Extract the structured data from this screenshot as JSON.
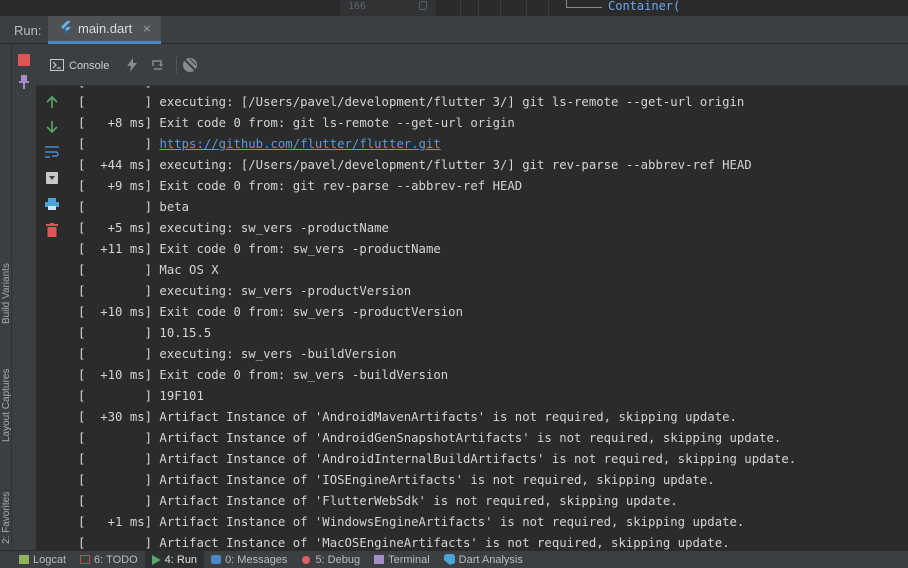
{
  "editor": {
    "line_number": "166",
    "code_fragment": "Container("
  },
  "run_panel": {
    "label": "Run:",
    "tab_label": "main.dart",
    "tab_close": "×"
  },
  "left_stripe": {
    "labels": [
      "Build Variants",
      "Layout Captures",
      "2: Favorites"
    ]
  },
  "toolbar": {
    "console_label": "Console"
  },
  "console_lines": [
    "[        ] executing: [/Users/pavel/development/flutter 3/] git ls-remote --get-url origin",
    "[   +8 ms] Exit code 0 from: git ls-remote --get-url origin",
    "[        ] ",
    "[  +44 ms] executing: [/Users/pavel/development/flutter 3/] git rev-parse --abbrev-ref HEAD",
    "[   +9 ms] Exit code 0 from: git rev-parse --abbrev-ref HEAD",
    "[        ] beta",
    "[   +5 ms] executing: sw_vers -productName",
    "[  +11 ms] Exit code 0 from: sw_vers -productName",
    "[        ] Mac OS X",
    "[        ] executing: sw_vers -productVersion",
    "[  +10 ms] Exit code 0 from: sw_vers -productVersion",
    "[        ] 10.15.5",
    "[        ] executing: sw_vers -buildVersion",
    "[  +10 ms] Exit code 0 from: sw_vers -buildVersion",
    "[        ] 19F101",
    "[  +30 ms] Artifact Instance of 'AndroidMavenArtifacts' is not required, skipping update.",
    "[        ] Artifact Instance of 'AndroidGenSnapshotArtifacts' is not required, skipping update.",
    "[        ] Artifact Instance of 'AndroidInternalBuildArtifacts' is not required, skipping update.",
    "[        ] Artifact Instance of 'IOSEngineArtifacts' is not required, skipping update.",
    "[        ] Artifact Instance of 'FlutterWebSdk' is not required, skipping update.",
    "[   +1 ms] Artifact Instance of 'WindowsEngineArtifacts' is not required, skipping update.",
    "[        ] Artifact Instance of 'MacOSEngineArtifacts' is not required, skipping update."
  ],
  "console_link": "https://github.com/flutter/flutter.git",
  "bottom_tabs": [
    {
      "name": "logcat",
      "label": "Logcat",
      "icon": "logcat-icon",
      "color": "#8fb55e"
    },
    {
      "name": "todo",
      "label": "6: TODO",
      "icon": "todo-icon",
      "color": "#c05050"
    },
    {
      "name": "run",
      "label": "4: Run",
      "icon": "run-icon",
      "color": "#59a869",
      "active": true
    },
    {
      "name": "messages",
      "label": "0: Messages",
      "icon": "messages-icon",
      "color": "#4a88c7"
    },
    {
      "name": "debug",
      "label": "5: Debug",
      "icon": "debug-icon",
      "color": "#e06060"
    },
    {
      "name": "terminal",
      "label": "Terminal",
      "icon": "terminal-icon",
      "color": "#a58fc9"
    },
    {
      "name": "dart-analysis",
      "label": "Dart Analysis",
      "icon": "dart-analysis-icon",
      "color": "#4aa5d6"
    }
  ],
  "colors": {
    "accent": "#4a88c7",
    "stop": "#e05555",
    "link": "#5c9bd6",
    "up_arrow": "#59a869"
  }
}
